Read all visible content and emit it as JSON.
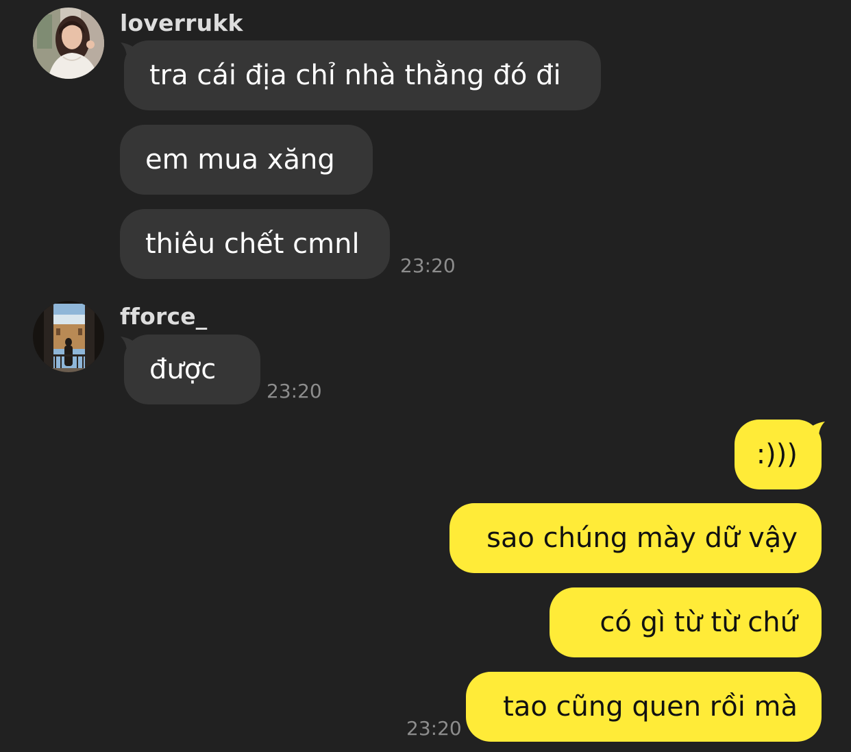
{
  "chat": {
    "groups": [
      {
        "sender": "loverrukk",
        "avatar_icon": "profile-photo-woman",
        "messages": [
          "tra cái địa chỉ nhà thằng đó đi",
          "em mua xăng",
          "thiêu chết cmnl"
        ],
        "time": "23:20"
      },
      {
        "sender": "fforce_",
        "avatar_icon": "profile-photo-balcony",
        "messages": [
          "được"
        ],
        "time": "23:20"
      },
      {
        "sender": "",
        "messages": [
          ":)))",
          "sao chúng mày dữ vậy",
          "có gì từ từ chứ",
          "tao cũng quen rồi mà"
        ],
        "time": "23:20"
      }
    ]
  },
  "colors": {
    "background": "#212121",
    "incoming_bubble": "#363636",
    "outgoing_bubble": "#ffeb38",
    "timestamp": "#8d8d8d"
  }
}
